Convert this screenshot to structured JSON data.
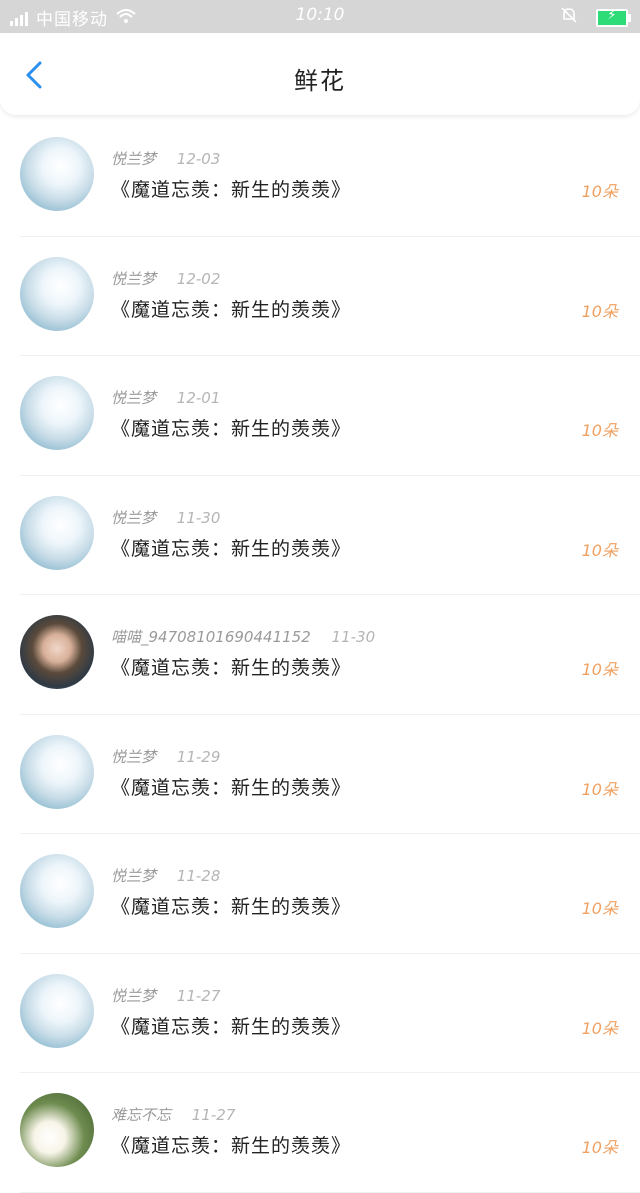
{
  "status_bar": {
    "carrier": "中国移动",
    "time": "10:10"
  },
  "header": {
    "title": "鲜花"
  },
  "items": [
    {
      "user": "悦兰梦",
      "date": "12-03",
      "book": "《魔道忘羡：新生的羡羡》",
      "amount": "10朵",
      "avatar": "flower"
    },
    {
      "user": "悦兰梦",
      "date": "12-02",
      "book": "《魔道忘羡：新生的羡羡》",
      "amount": "10朵",
      "avatar": "flower"
    },
    {
      "user": "悦兰梦",
      "date": "12-01",
      "book": "《魔道忘羡：新生的羡羡》",
      "amount": "10朵",
      "avatar": "flower"
    },
    {
      "user": "悦兰梦",
      "date": "11-30",
      "book": "《魔道忘羡：新生的羡羡》",
      "amount": "10朵",
      "avatar": "flower"
    },
    {
      "user": "喵喵_94708101690441152",
      "date": "11-30",
      "book": "《魔道忘羡：新生的羡羡》",
      "amount": "10朵",
      "avatar": "girl"
    },
    {
      "user": "悦兰梦",
      "date": "11-29",
      "book": "《魔道忘羡：新生的羡羡》",
      "amount": "10朵",
      "avatar": "flower"
    },
    {
      "user": "悦兰梦",
      "date": "11-28",
      "book": "《魔道忘羡：新生的羡羡》",
      "amount": "10朵",
      "avatar": "flower"
    },
    {
      "user": "悦兰梦",
      "date": "11-27",
      "book": "《魔道忘羡：新生的羡羡》",
      "amount": "10朵",
      "avatar": "flower"
    },
    {
      "user": "难忘不忘",
      "date": "11-27",
      "book": "《魔道忘羡：新生的羡羡》",
      "amount": "10朵",
      "avatar": "white"
    }
  ],
  "colors": {
    "accent_back": "#2b8ff0",
    "amount": "#f0a060",
    "status_bar_bg": "#d6d6d6"
  }
}
